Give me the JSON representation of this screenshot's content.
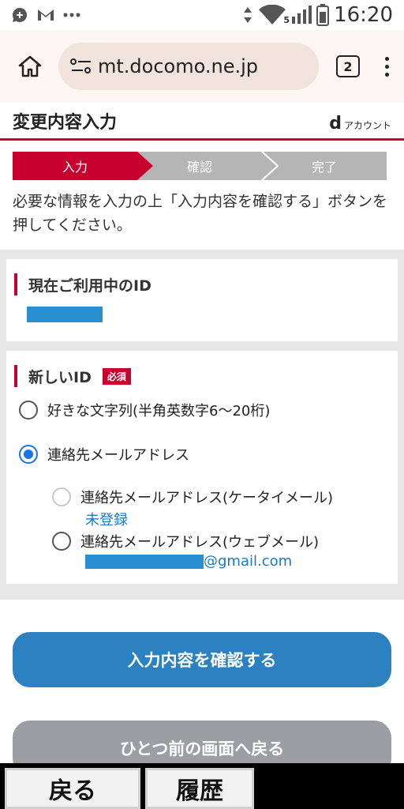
{
  "status_bar": {
    "time": "16:20",
    "network_badge": "5",
    "icons": [
      "chat-icon",
      "gmail-icon",
      "more-dots-icon",
      "data-arrows-icon",
      "wifi-icon",
      "signal-icon",
      "battery-icon"
    ]
  },
  "browser": {
    "url": "mt.docomo.ne.jp",
    "tab_count": "2"
  },
  "header": {
    "title": "変更内容入力",
    "brand_d": "d",
    "brand_text": "アカウント"
  },
  "steps": [
    "入力",
    "確認",
    "完了"
  ],
  "intro": "必要な情報を入力の上「入力内容を確認する」ボタンを押してください。",
  "current_id": {
    "title": "現在ご利用中のID"
  },
  "new_id": {
    "title": "新しいID",
    "required_badge": "必須",
    "options": [
      {
        "label": "好きな文字列(半角英数字6〜20桁)",
        "checked": false
      },
      {
        "label": "連絡先メールアドレス",
        "checked": true
      }
    ],
    "sub_options": [
      {
        "label": "連絡先メールアドレス(ケータイメール)",
        "value": "未登録",
        "disabled": true
      },
      {
        "label": "連絡先メールアドレス(ウェブメール)",
        "value_suffix": "@gmail.com",
        "disabled": false
      }
    ]
  },
  "buttons": {
    "confirm": "入力内容を確認する",
    "back": "ひとつ前の画面へ戻る"
  },
  "bottom_bar": {
    "back": "戻る",
    "history": "履歴"
  },
  "colors": {
    "accent_red": "#c8002d",
    "primary_blue": "#2c82c0",
    "link_blue": "#1a7ac7"
  }
}
